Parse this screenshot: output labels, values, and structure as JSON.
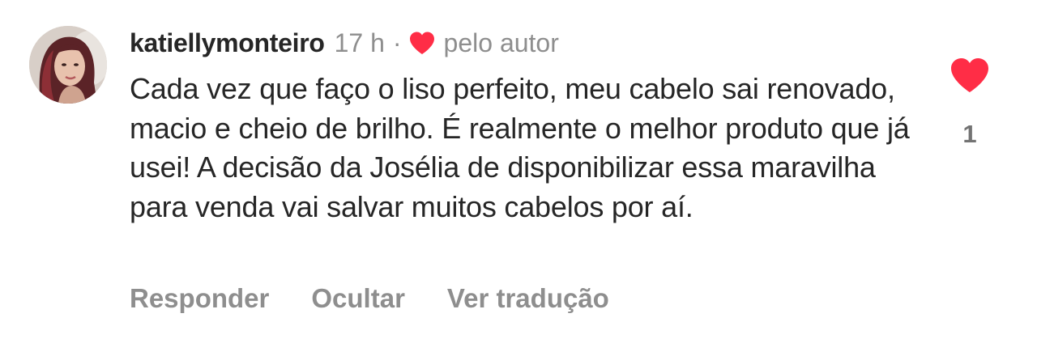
{
  "comment": {
    "username": "katiellymonteiro",
    "time": "17 h",
    "separator": "·",
    "liked_by_author_label": "pelo autor",
    "text": "Cada vez que faço o liso perfeito, meu cabelo sai renovado, macio e cheio de brilho. É realmente o melhor produto que já usei! A decisão da Josélia de disponibilizar essa maravilha para venda vai salvar muitos cabelos por aí.",
    "like_count": "1"
  },
  "actions": {
    "reply_label": "Responder",
    "hide_label": "Ocultar",
    "translate_label": "Ver tradução"
  },
  "colors": {
    "heart": "#ff2d46",
    "text": "#262626",
    "muted": "#8e8e8e"
  },
  "icons": {
    "small_heart": "heart-icon",
    "like_button": "heart-filled-icon",
    "avatar": "profile-photo"
  }
}
